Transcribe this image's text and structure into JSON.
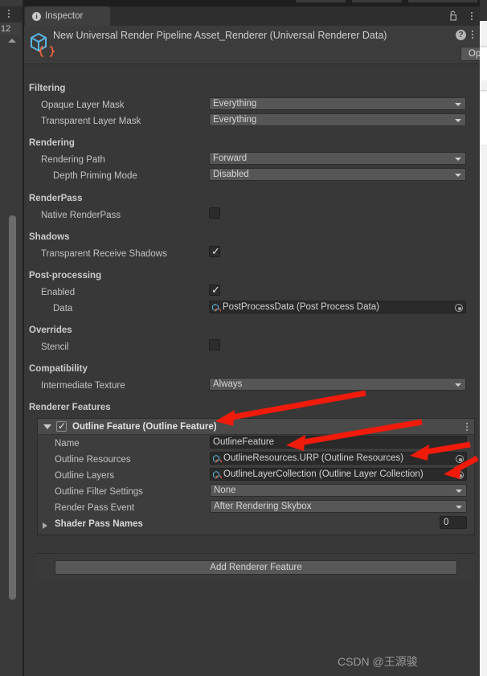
{
  "left_strip": {
    "kebab": "kebab-menu",
    "number_label": "12"
  },
  "tab": {
    "label": "Inspector",
    "icon": "info-icon",
    "lock_icon": "padlock-unlocked-icon",
    "kebab": "kebab-menu"
  },
  "object_header": {
    "title": "New Universal Render Pipeline Asset_Renderer (Universal Renderer Data)",
    "icon": "scriptable-object-icon",
    "help_icon": "help-icon",
    "kebab": "kebab-menu",
    "open_button": "Open"
  },
  "sections": [
    {
      "title": "Filtering",
      "rows": [
        {
          "label": "Opaque Layer Mask",
          "type": "dropdown",
          "value": "Everything"
        },
        {
          "label": "Transparent Layer Mask",
          "type": "dropdown",
          "value": "Everything"
        }
      ]
    },
    {
      "title": "Rendering",
      "rows": [
        {
          "label": "Rendering Path",
          "type": "dropdown",
          "value": "Forward"
        },
        {
          "label": "Depth Priming Mode",
          "type": "dropdown",
          "value": "Disabled"
        }
      ]
    },
    {
      "title": "RenderPass",
      "rows": [
        {
          "label": "Native RenderPass",
          "type": "checkbox",
          "value": false
        }
      ]
    },
    {
      "title": "Shadows",
      "rows": [
        {
          "label": "Transparent Receive Shadows",
          "type": "checkbox",
          "value": true
        }
      ]
    },
    {
      "title": "Post-processing",
      "rows": [
        {
          "label": "Enabled",
          "type": "checkbox",
          "value": true
        },
        {
          "label": "Data",
          "type": "object",
          "value": "PostProcessData (Post Process Data)"
        }
      ]
    },
    {
      "title": "Overrides",
      "rows": [
        {
          "label": "Stencil",
          "type": "checkbox",
          "value": false
        }
      ]
    },
    {
      "title": "Compatibility",
      "rows": [
        {
          "label": "Intermediate Texture",
          "type": "dropdown",
          "value": "Always"
        }
      ]
    },
    {
      "title": "Renderer Features",
      "rows": []
    }
  ],
  "renderer_feature": {
    "header_label": "Outline Feature (Outline Feature)",
    "enabled": true,
    "expanded": true,
    "kebab": "kebab-menu",
    "rows": [
      {
        "label": "Name",
        "type": "text",
        "value": "OutlineFeature"
      },
      {
        "label": "Outline Resources",
        "type": "object",
        "value": "OutlineResources.URP (Outline Resources)"
      },
      {
        "label": "Outline Layers",
        "type": "object",
        "value": "OutlineLayerCollection (Outline Layer Collection)"
      },
      {
        "label": "Outline Filter Settings",
        "type": "dropdown",
        "value": "None"
      },
      {
        "label": "Render Pass Event",
        "type": "dropdown",
        "value": "After Rendering Skybox"
      },
      {
        "label": "Shader Pass Names",
        "type": "foldout-number",
        "value": "0"
      }
    ]
  },
  "add_feature_button": "Add Renderer Feature",
  "watermark": "CSDN @王源骏",
  "colors": {
    "window_bg": "#383838",
    "panel_bg": "#3c3c3c",
    "dropdown_bg": "#565656",
    "field_bg": "#2a2a2a",
    "text": "#c3c3c3",
    "accent_arrow": "#f01b0b",
    "icon_blue": "#4fa8d8",
    "icon_orange": "#e8613a"
  }
}
